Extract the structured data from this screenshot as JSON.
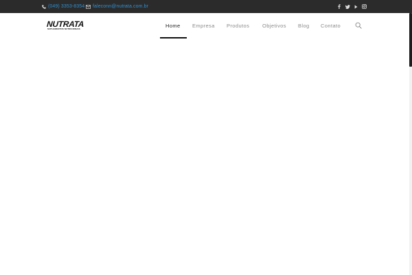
{
  "topbar": {
    "phone": "(049) 3353-8354",
    "email": "faleconn@nutrata.com.br",
    "phone_icon": "phone-icon",
    "email_icon": "envelope-icon",
    "social_icons": [
      "facebook-icon",
      "twitter-icon",
      "youtube-icon",
      "instagram-icon"
    ],
    "link_color": "#2e8fd0",
    "background": "#2b2b2b"
  },
  "header": {
    "logo": {
      "name": "NUTRATA",
      "tagline": "SUPLEMENTOS NUTRICIONAIS"
    },
    "nav": [
      {
        "label": "Home",
        "active": true
      },
      {
        "label": "Empresa",
        "active": false
      },
      {
        "label": "Produtos",
        "active": false
      },
      {
        "label": "Objetivos",
        "active": false
      },
      {
        "label": "Blog",
        "active": false
      },
      {
        "label": "Contato",
        "active": false
      }
    ],
    "search_icon": "search-icon"
  }
}
